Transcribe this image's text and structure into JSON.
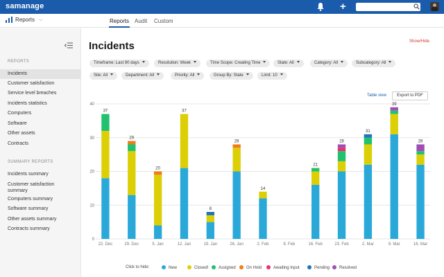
{
  "header": {
    "logo_text": "samanage",
    "search_placeholder": ""
  },
  "subnav": {
    "module": "Reports",
    "tabs": [
      {
        "label": "Reports",
        "active": true
      },
      {
        "label": "Audit",
        "active": false
      },
      {
        "label": "Custom",
        "active": false
      }
    ]
  },
  "sidebar": {
    "reports_heading": "REPORTS",
    "reports_items": [
      {
        "label": "Incidents",
        "active": true
      },
      {
        "label": "Customer satisfaction",
        "active": false
      },
      {
        "label": "Service level breaches",
        "active": false
      },
      {
        "label": "Incidents statistics",
        "active": false
      },
      {
        "label": "Computers",
        "active": false
      },
      {
        "label": "Software",
        "active": false
      },
      {
        "label": "Other assets",
        "active": false
      },
      {
        "label": "Contracts",
        "active": false
      }
    ],
    "summary_heading": "SUMMARY REPORTS",
    "summary_items": [
      {
        "label": "Incidents summary"
      },
      {
        "label": "Customer satisfaction summary"
      },
      {
        "label": "Computers summary"
      },
      {
        "label": "Software summary"
      },
      {
        "label": "Other assets summary"
      },
      {
        "label": "Contracts summary"
      }
    ]
  },
  "main": {
    "title": "Incidents",
    "show_hide": "Show/Hide",
    "filters_row1": [
      "Timeframe: Last 90 days",
      "Resolution: Week",
      "Time Scope: Creating Time",
      "State: All",
      "Category: All",
      "Subcategory: All"
    ],
    "filters_row2": [
      "Site: All",
      "Department: All",
      "Priority: All",
      "Group By: State",
      "Limit: 10"
    ],
    "table_view": "Table view",
    "export_pdf": "Export to PDF",
    "legend_prefix": "Click to hide:"
  },
  "colors": {
    "brand": "#1a5cab",
    "New": "#2aa9d9",
    "Closed!": "#dccf06",
    "Assigned": "#20c16f",
    "On Hold": "#f07c17",
    "Awaiting Input": "#ec2f6b",
    "Pending": "#1f73b8",
    "Resolved": "#a14db8"
  },
  "chart_data": {
    "type": "bar",
    "stacked": true,
    "categories": [
      "22. Dec",
      "29. Dec",
      "5. Jan",
      "12. Jan",
      "19. Jan",
      "26. Jan",
      "2. Feb",
      "9. Feb",
      "16. Feb",
      "23. Feb",
      "2. Mar",
      "9. Mar",
      "16. Mar"
    ],
    "totals": [
      37,
      29,
      20,
      37,
      8,
      28,
      14,
      null,
      21,
      28,
      31,
      39,
      28
    ],
    "series": [
      {
        "name": "New",
        "values": [
          18,
          13,
          4,
          21,
          5,
          20,
          12,
          0,
          16,
          20,
          22,
          31,
          22
        ]
      },
      {
        "name": "Closed!",
        "values": [
          14,
          13,
          15,
          16,
          2,
          7,
          2,
          0,
          4,
          3,
          6,
          6,
          3
        ]
      },
      {
        "name": "Assigned",
        "values": [
          5,
          2,
          0,
          0,
          0,
          0,
          0,
          0,
          1,
          3,
          2,
          1,
          1
        ]
      },
      {
        "name": "On Hold",
        "values": [
          0,
          1,
          1,
          0,
          0,
          1,
          0,
          0,
          0,
          0,
          0,
          0,
          0
        ]
      },
      {
        "name": "Awaiting Input",
        "values": [
          0,
          0,
          0,
          0,
          0,
          0,
          0,
          0,
          0,
          1,
          0,
          0,
          0
        ]
      },
      {
        "name": "Pending",
        "values": [
          0,
          0,
          0,
          0,
          1,
          0,
          0,
          0,
          0,
          0,
          1,
          0,
          0
        ]
      },
      {
        "name": "Resolved",
        "values": [
          0,
          0,
          0,
          0,
          0,
          0,
          0,
          0,
          0,
          1,
          0,
          1,
          2
        ]
      }
    ],
    "ylim": [
      0,
      40
    ],
    "yticks": [
      0,
      10,
      20,
      30,
      40
    ],
    "grid": true,
    "legend_position": "bottom"
  }
}
